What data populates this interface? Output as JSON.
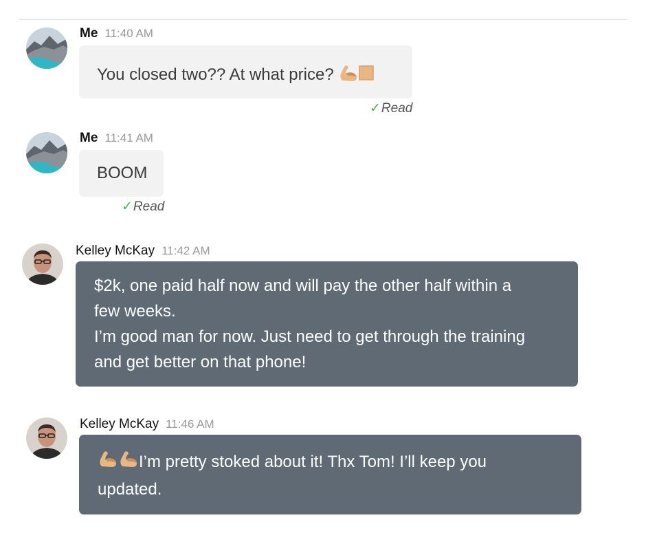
{
  "colors": {
    "my_bubble": "#f2f2f2",
    "their_bubble": "#5f6a74",
    "read_check": "#4caf50",
    "timestamp": "#9a9a9a"
  },
  "messages": [
    {
      "sender": "Me",
      "time": "11:40 AM",
      "text": "You closed two?? At what price?",
      "emoji": [
        "flexed-biceps-icon",
        "skin-tone-square-icon"
      ],
      "status": "Read"
    },
    {
      "sender": "Me",
      "time": "11:41 AM",
      "text": "BOOM",
      "status": "Read"
    },
    {
      "sender": "Kelley McKay",
      "time": "11:42 AM",
      "lines": [
        "$2k, one paid half now and will pay the other half within a",
        "few weeks.",
        "I’m good man for now. Just need to get through the training",
        "and get better on that phone!"
      ]
    },
    {
      "sender": "Kelley McKay",
      "time": "11:46 AM",
      "emoji": [
        "flexed-biceps-icon",
        "flexed-biceps-icon"
      ],
      "lines": [
        "I’m pretty stoked about it! Thx Tom! I’ll keep you",
        "updated."
      ]
    }
  ]
}
